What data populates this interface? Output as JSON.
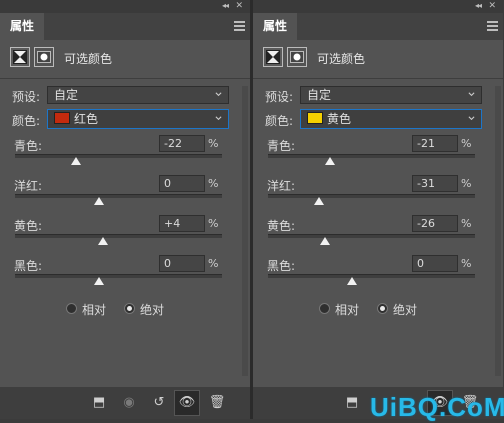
{
  "panels": [
    {
      "tab": "属性",
      "title": "可选颜色",
      "preset_label": "预设:",
      "preset_value": "自定",
      "color_label": "颜色:",
      "color_value": "红色",
      "swatch_color": "#c32a0e",
      "sliders": [
        {
          "label": "青色:",
          "value": "-22",
          "unit": "%",
          "level": -22
        },
        {
          "label": "洋红:",
          "value": "0",
          "unit": "%",
          "level": 0
        },
        {
          "label": "黄色:",
          "value": "+4",
          "unit": "%",
          "level": 4
        },
        {
          "label": "黑色:",
          "value": "0",
          "unit": "%",
          "level": 0
        }
      ],
      "radio_relative": "相对",
      "radio_absolute": "绝对",
      "selected_mode": "absolute"
    },
    {
      "tab": "属性",
      "title": "可选颜色",
      "preset_label": "预设:",
      "preset_value": "自定",
      "color_label": "颜色:",
      "color_value": "黄色",
      "swatch_color": "#f5d000",
      "sliders": [
        {
          "label": "青色:",
          "value": "-21",
          "unit": "%",
          "level": -21
        },
        {
          "label": "洋红:",
          "value": "-31",
          "unit": "%",
          "level": -31
        },
        {
          "label": "黄色:",
          "value": "-26",
          "unit": "%",
          "level": -26
        },
        {
          "label": "黑色:",
          "value": "0",
          "unit": "%",
          "level": 0
        }
      ],
      "radio_relative": "相对",
      "radio_absolute": "绝对",
      "selected_mode": "absolute"
    }
  ],
  "footer_icons": [
    "clip-to-layer-icon",
    "visibility-toggle-icon",
    "reset-icon",
    "eye-icon",
    "trash-icon"
  ],
  "watermark": "UiBQ.CoM"
}
